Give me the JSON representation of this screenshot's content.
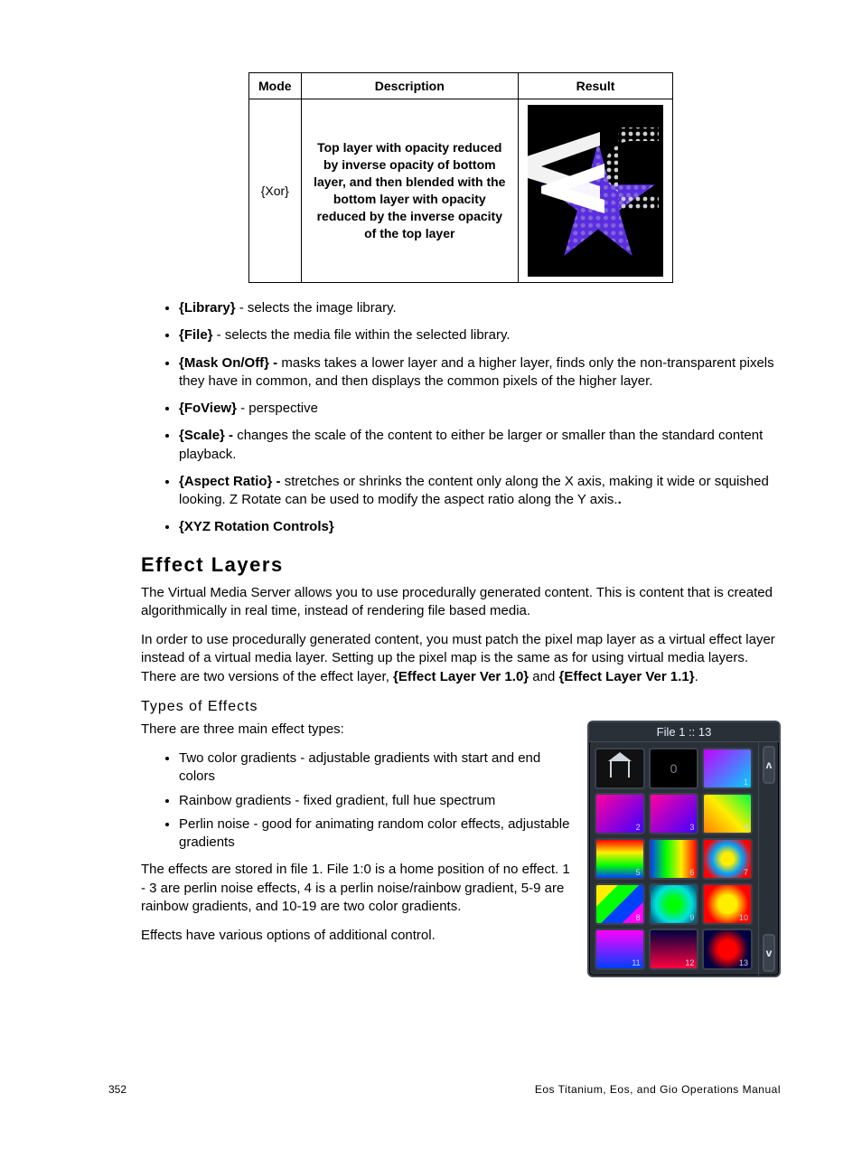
{
  "table": {
    "headers": {
      "mode": "Mode",
      "description": "Description",
      "result": "Result"
    },
    "row": {
      "mode": "{Xor}",
      "description": "Top layer with opacity reduced by inverse opacity of bottom layer, and then blended with the bottom layer with opacity reduced by the inverse opacity of the top layer"
    }
  },
  "bullets": [
    {
      "term": "{Library}",
      "text": " - selects the image library."
    },
    {
      "term": "{File}",
      "text": " - selects the media file within the selected library."
    },
    {
      "term": "{Mask On/Off} -",
      "text": " masks takes a lower layer and a higher layer, finds only the non-transparent pixels they have in common, and then displays the common pixels of the higher layer."
    },
    {
      "term": "{FoView}",
      "text": " - perspective"
    },
    {
      "term": "{Scale} -",
      "text": " changes the scale of the content to either be larger or smaller than the standard content playback."
    },
    {
      "term": "{Aspect Ratio} -",
      "text": " stretches or shrinks the content only along the X axis, making it wide or squished looking. Z Rotate can be used to modify the aspect ratio along the Y axis."
    },
    {
      "term": "{XYZ Rotation Controls}",
      "text": ""
    }
  ],
  "section_title": "Effect Layers",
  "para1": "The Virtual Media Server allows you to use procedurally generated content. This is content that is created algorithmically in real time, instead of rendering file based media.",
  "para2_pre": "In order to use procedurally generated content, you must patch the pixel map layer as a virtual effect layer instead of a virtual media layer. Setting up the pixel map is the same as for using virtual media layers. There are two versions of the effect layer, ",
  "para2_b1": "{Effect Layer Ver 1.0}",
  "para2_mid": " and ",
  "para2_b2": "{Effect Layer Ver 1.1}",
  "para2_end": ".",
  "subsection_title": "Types of Effects",
  "intro_line": "There are three main effect types:",
  "effect_types": [
    "Two color gradients - adjustable gradients with start and end colors",
    "Rainbow gradients - fixed gradient, full hue spectrum",
    "Perlin noise - good for animating random color effects, adjustable gradients"
  ],
  "para3": "The effects are stored in file 1. File 1:0 is a home position of no effect. 1 - 3 are perlin noise effects, 4 is a perlin noise/rainbow gradient, 5-9 are rainbow gradients, and 10-19 are two color gradients.",
  "para4": "Effects have various options of additional control.",
  "panel": {
    "title": "File 1 :: 13",
    "cells": [
      "",
      "0",
      "1",
      "2",
      "3",
      "4",
      "5",
      "6",
      "7",
      "8",
      "9",
      "10",
      "11",
      "12",
      "13"
    ],
    "up": "ʌ",
    "down": "v"
  },
  "footer": {
    "page": "352",
    "manual": "Eos Titanium, Eos, and Gio Operations Manual"
  }
}
